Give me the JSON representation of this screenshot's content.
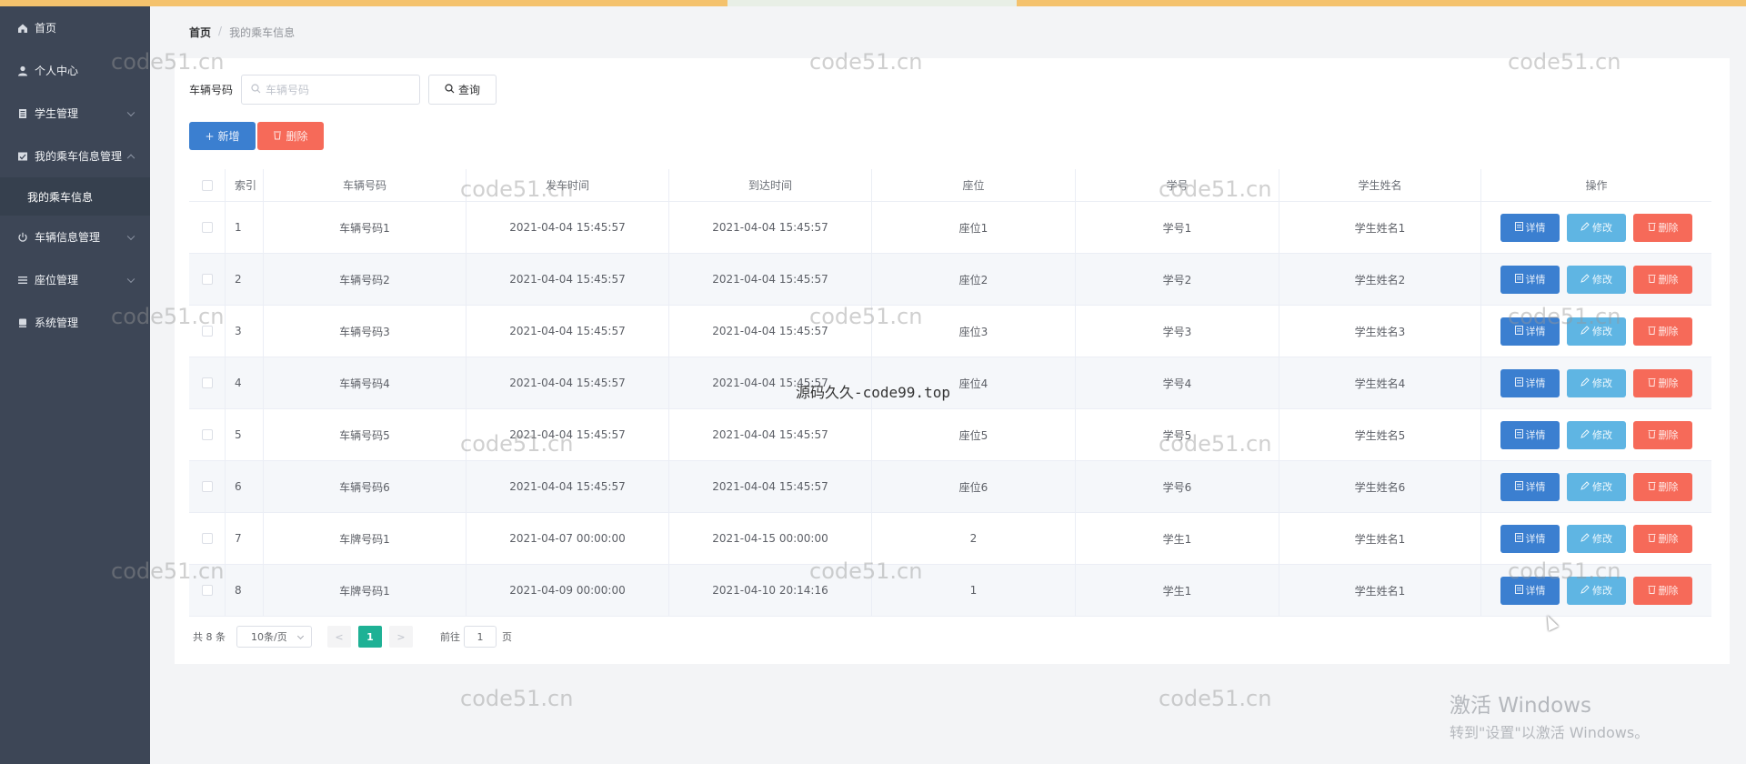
{
  "sidebar": {
    "items": [
      {
        "icon": "home-icon",
        "label": "首页",
        "has_chevron": false
      },
      {
        "icon": "user-icon",
        "label": "个人中心",
        "has_chevron": false
      },
      {
        "icon": "student-icon",
        "label": "学生管理",
        "has_chevron": true
      },
      {
        "icon": "ride-icon",
        "label": "我的乘车信息管理",
        "has_chevron": true,
        "expanded": true
      },
      {
        "icon": "power-icon",
        "label": "车辆信息管理",
        "has_chevron": true
      },
      {
        "icon": "list-icon",
        "label": "座位管理",
        "has_chevron": true
      },
      {
        "icon": "system-icon",
        "label": "系统管理",
        "has_chevron": false
      }
    ],
    "submenu": {
      "label": "我的乘车信息"
    }
  },
  "breadcrumb": {
    "home": "首页",
    "separator": "/",
    "current": "我的乘车信息"
  },
  "search": {
    "label": "车辆号码",
    "placeholder": "车辆号码",
    "query_label": "查询"
  },
  "actions": {
    "add_label": "新增",
    "delete_label": "删除"
  },
  "table": {
    "headers": [
      "索引",
      "车辆号码",
      "发车时间",
      "到达时间",
      "座位",
      "学号",
      "学生姓名",
      "操作"
    ],
    "rows": [
      {
        "index": "1",
        "plate": "车辆号码1",
        "departure": "2021-04-04 15:45:57",
        "arrival": "2021-04-04 15:45:57",
        "seat": "座位1",
        "student_no": "学号1",
        "student_name": "学生姓名1"
      },
      {
        "index": "2",
        "plate": "车辆号码2",
        "departure": "2021-04-04 15:45:57",
        "arrival": "2021-04-04 15:45:57",
        "seat": "座位2",
        "student_no": "学号2",
        "student_name": "学生姓名2"
      },
      {
        "index": "3",
        "plate": "车辆号码3",
        "departure": "2021-04-04 15:45:57",
        "arrival": "2021-04-04 15:45:57",
        "seat": "座位3",
        "student_no": "学号3",
        "student_name": "学生姓名3"
      },
      {
        "index": "4",
        "plate": "车辆号码4",
        "departure": "2021-04-04 15:45:57",
        "arrival": "2021-04-04 15:45:57",
        "seat": "座位4",
        "student_no": "学号4",
        "student_name": "学生姓名4"
      },
      {
        "index": "5",
        "plate": "车辆号码5",
        "departure": "2021-04-04 15:45:57",
        "arrival": "2021-04-04 15:45:57",
        "seat": "座位5",
        "student_no": "学号5",
        "student_name": "学生姓名5"
      },
      {
        "index": "6",
        "plate": "车辆号码6",
        "departure": "2021-04-04 15:45:57",
        "arrival": "2021-04-04 15:45:57",
        "seat": "座位6",
        "student_no": "学号6",
        "student_name": "学生姓名6"
      },
      {
        "index": "7",
        "plate": "车牌号码1",
        "departure": "2021-04-07 00:00:00",
        "arrival": "2021-04-15 00:00:00",
        "seat": "2",
        "student_no": "学生1",
        "student_name": "学生姓名1"
      },
      {
        "index": "8",
        "plate": "车牌号码1",
        "departure": "2021-04-09 00:00:00",
        "arrival": "2021-04-10 20:14:16",
        "seat": "1",
        "student_no": "学生1",
        "student_name": "学生姓名1"
      }
    ],
    "row_actions": {
      "detail": "详情",
      "edit": "修改",
      "delete": "删除"
    }
  },
  "pagination": {
    "total": "共 8 条",
    "page_size": "10条/页",
    "current_page": "1",
    "goto_label": "前往",
    "goto_value": "1",
    "page_unit": "页"
  },
  "watermarks": {
    "site": "code51.cn",
    "center": "源码久久-code99.top"
  },
  "windows_activation": {
    "title": "激活 Windows",
    "subtitle": "转到\"设置\"以激活 Windows。"
  },
  "colors": {
    "primary": "#3b7fd0",
    "info": "#5fb5e3",
    "danger": "#f66a59",
    "pager_active": "#1eb195",
    "sidebar_bg": "#3d4656"
  }
}
